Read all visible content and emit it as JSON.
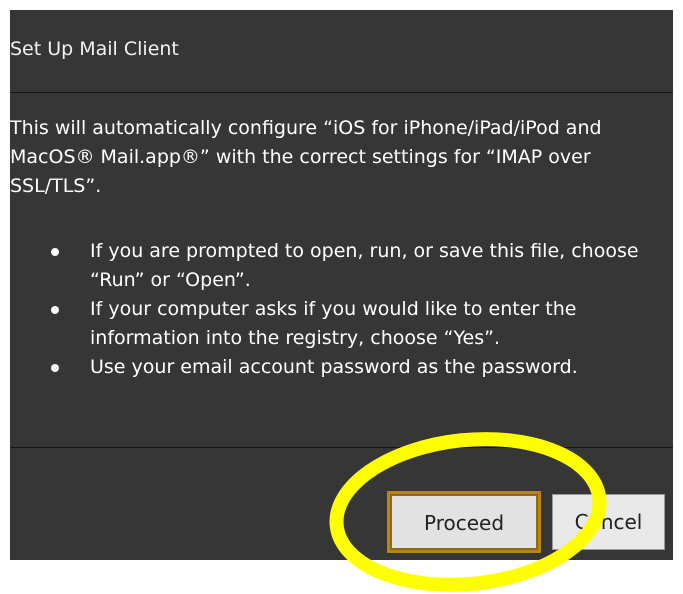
{
  "dialog": {
    "title": "Set Up Mail Client",
    "description": "This will automatically configure “iOS for iPhone/iPad/iPod and MacOS® Mail.app®” with the correct settings for “IMAP over SSL/TLS”.",
    "bullets": [
      "If you are prompted to open, run, or save this file, choose “Run” or “Open”.",
      "If your computer asks if you would like to enter the information into the registry, choose “Yes”.",
      "Use your email account password as the password."
    ],
    "buttons": {
      "proceed_label": "Proceed",
      "cancel_label": "Cancel"
    }
  },
  "annotation": {
    "highlight_color": "#ffff00",
    "highlight_shape": "ellipse",
    "highlight_target": "proceed-button"
  },
  "colors": {
    "dialog_background": "#363636",
    "text": "#ffffff",
    "button_background": "#e9e9e9"
  }
}
